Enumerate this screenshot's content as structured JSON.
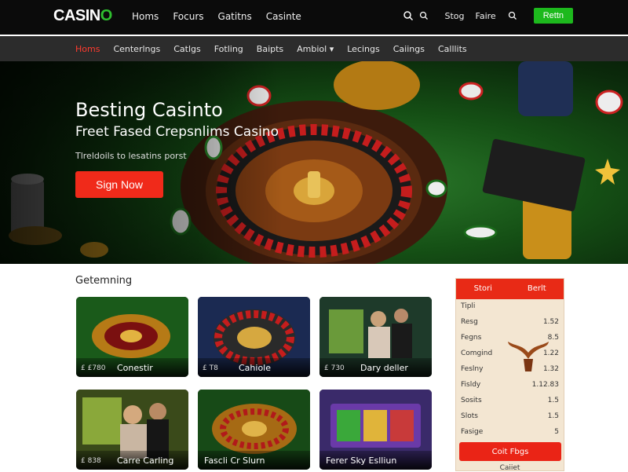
{
  "brand": {
    "logo_pre": "CASIN",
    "logo_o": "O"
  },
  "topnav": {
    "items": [
      "Homs",
      "Focurs",
      "Gatitns",
      "Casinte"
    ]
  },
  "topright": {
    "link1": "Stog",
    "link2": "Faire",
    "login": "Rettn"
  },
  "catnav": {
    "items": [
      "Homs",
      "Centerlngs",
      "Catlgs",
      "Fotling",
      "Baipts",
      "Ambiol ▾",
      "Lecings",
      "Caiings",
      "Calllits"
    ],
    "active_index": 0
  },
  "hero": {
    "title": "Besting Casinto",
    "subtitle": "Freet Fased Crepsnlims Casino",
    "small": "Tlreldoils to lesatins porst",
    "cta": "Sign Now"
  },
  "games": {
    "section_title": "Getemning",
    "cards": [
      {
        "price": "£ £780",
        "name": "Conestir"
      },
      {
        "price": "£ T8",
        "name": "Cahiole"
      },
      {
        "price": "£ 730",
        "name": "Dary deller"
      },
      {
        "price": "£ 838",
        "name": "Carre Carling"
      },
      {
        "price": "",
        "name": "Fascli Cr Slurn"
      },
      {
        "price": "",
        "name": "Ferer Sky Eslliun"
      }
    ]
  },
  "panel": {
    "tab1": "Stori",
    "tab2": "Berlt",
    "rows": [
      {
        "k": "Tipli",
        "v": ""
      },
      {
        "k": "Resg",
        "v": "1.52"
      },
      {
        "k": "Fegns",
        "v": "8.5"
      },
      {
        "k": "Comgind",
        "v": "1.22"
      },
      {
        "k": "Feslny",
        "v": "1.32"
      },
      {
        "k": "Fisldy",
        "v": "1.12.83"
      },
      {
        "k": "Sosits",
        "v": "1.5"
      },
      {
        "k": "Slots",
        "v": "1.5"
      },
      {
        "k": "Fasige",
        "v": "5"
      }
    ],
    "button": "Coit Fbgs",
    "footer": "Caiiet"
  },
  "colors": {
    "accent_red": "#f02a1a",
    "accent_green": "#1db91d",
    "topbar": "#0b0b0b",
    "catbar": "#2c2c2c"
  }
}
